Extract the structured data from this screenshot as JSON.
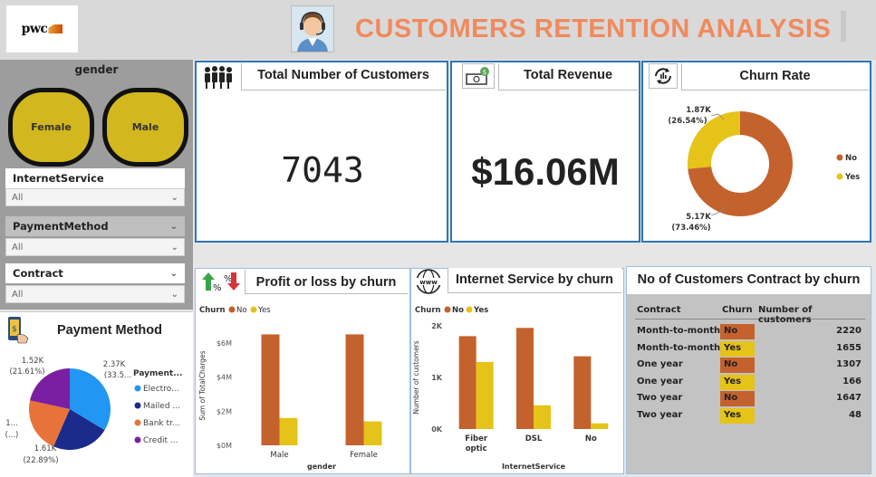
{
  "header": {
    "logo_text": "pwc",
    "title": "CUSTOMERS RETENTION ANALYSIS"
  },
  "slicers": {
    "gender": {
      "title": "gender",
      "options": [
        "Female",
        "Male"
      ]
    },
    "internet_service": {
      "label": "InternetService",
      "value": "All"
    },
    "payment_method": {
      "label": "PaymentMethod",
      "value": "All"
    },
    "contract": {
      "label": "Contract",
      "value": "All"
    }
  },
  "kpis": {
    "total_customers": {
      "title": "Total Number of Customers",
      "value": "7043"
    },
    "total_revenue": {
      "title": "Total Revenue",
      "value": "$16.06M"
    },
    "churn_rate": {
      "title": "Churn Rate"
    }
  },
  "sections": {
    "payment_method_title": "Payment Method",
    "profit_title": "Profit or loss by churn",
    "internet_title": "Internet Service by churn",
    "contract_title": "No of Customers Contract by churn"
  },
  "colors": {
    "no": "#c4622d",
    "yes": "#e5c318",
    "accent": "#2e75b6",
    "title": "#f08a5d"
  },
  "chart_data": [
    {
      "id": "churn_rate",
      "type": "pie",
      "donut": true,
      "categories": [
        "No",
        "Yes"
      ],
      "values": [
        5.17,
        1.87
      ],
      "value_labels": [
        "5.17K",
        "1.87K"
      ],
      "percent_labels": [
        "(73.46%)",
        "(26.54%)"
      ],
      "legend": [
        "No",
        "Yes"
      ]
    },
    {
      "id": "payment_method",
      "type": "pie",
      "legend_title": "Payment...",
      "categories": [
        "Electro...",
        "Mailed ...",
        "Bank tr...",
        "Credit ..."
      ],
      "colors": [
        "#2196f3",
        "#1a2b8c",
        "#e8733a",
        "#7b1fa2"
      ],
      "values": [
        2.37,
        1.61,
        1.54,
        1.52
      ],
      "value_labels": [
        "2.37K",
        "1.61K",
        "1...",
        "1.52K"
      ],
      "percent_labels": [
        "(33.5...",
        "(22.89%)",
        "(...)",
        "(21.61%)"
      ]
    },
    {
      "id": "profit_by_churn",
      "type": "bar",
      "legend_title": "Churn",
      "legend": [
        "No",
        "Yes"
      ],
      "categories": [
        "Male",
        "Female"
      ],
      "xlabel": "gender",
      "ylabel": "Sum of TotalCharges",
      "ylim": [
        0,
        7
      ],
      "yticks": [
        "$0M",
        "$2M",
        "$4M",
        "$6M"
      ],
      "series": [
        {
          "name": "No",
          "values": [
            6.5,
            6.5
          ]
        },
        {
          "name": "Yes",
          "values": [
            1.6,
            1.4
          ]
        }
      ]
    },
    {
      "id": "internet_by_churn",
      "type": "bar",
      "legend_title": "Churn",
      "legend": [
        "No",
        "Yes"
      ],
      "categories": [
        "Fiber optic",
        "DSL",
        "No"
      ],
      "xlabel": "InternetService",
      "ylabel": "Number of customers",
      "ylim": [
        0,
        2000
      ],
      "yticks": [
        "0K",
        "1K",
        "2K"
      ],
      "series": [
        {
          "name": "No",
          "values": [
            1800,
            1960,
            1410
          ]
        },
        {
          "name": "Yes",
          "values": [
            1300,
            460,
            110
          ]
        }
      ]
    },
    {
      "id": "contract_table",
      "type": "table",
      "columns": [
        "Contract",
        "Churn",
        "Number of customers"
      ],
      "rows": [
        [
          "Month-to-month",
          "No",
          "2220"
        ],
        [
          "Month-to-month",
          "Yes",
          "1655"
        ],
        [
          "One year",
          "No",
          "1307"
        ],
        [
          "One year",
          "Yes",
          "166"
        ],
        [
          "Two year",
          "No",
          "1647"
        ],
        [
          "Two year",
          "Yes",
          "48"
        ]
      ]
    }
  ]
}
